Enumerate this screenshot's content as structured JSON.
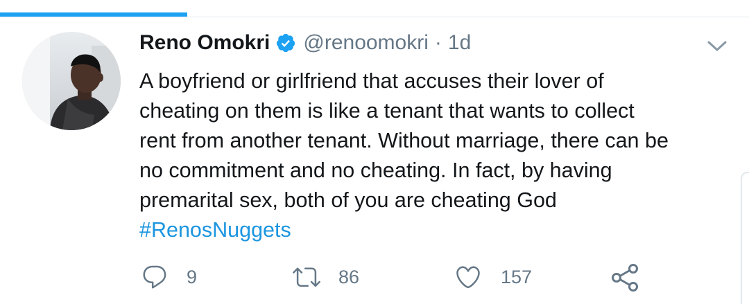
{
  "tweet": {
    "author_name": "Reno Omokri",
    "handle": "@renoomokri",
    "separator": "·",
    "time": "1d",
    "text_lines": [
      "A boyfriend or girlfriend that accuses their lover of",
      "cheating on them is like a tenant that wants to collect",
      "rent from another tenant. Without marriage, there can be",
      "no commitment and no cheating. In fact, by having",
      "premarital sex, both of you are cheating God"
    ],
    "hashtag": "#RenosNuggets",
    "verified": true
  },
  "actions": {
    "reply_count": "9",
    "retweet_count": "86",
    "like_count": "157"
  },
  "icons": {
    "verified": "verified-badge-icon",
    "caret": "chevron-down-icon",
    "reply": "reply-icon",
    "retweet": "retweet-icon",
    "like": "heart-icon",
    "share": "share-icon"
  },
  "colors": {
    "accent": "#1da1f2",
    "link": "#1b95e0",
    "secondary_text": "#657786",
    "primary_text": "#14171a",
    "divider": "#e1e8ed"
  }
}
